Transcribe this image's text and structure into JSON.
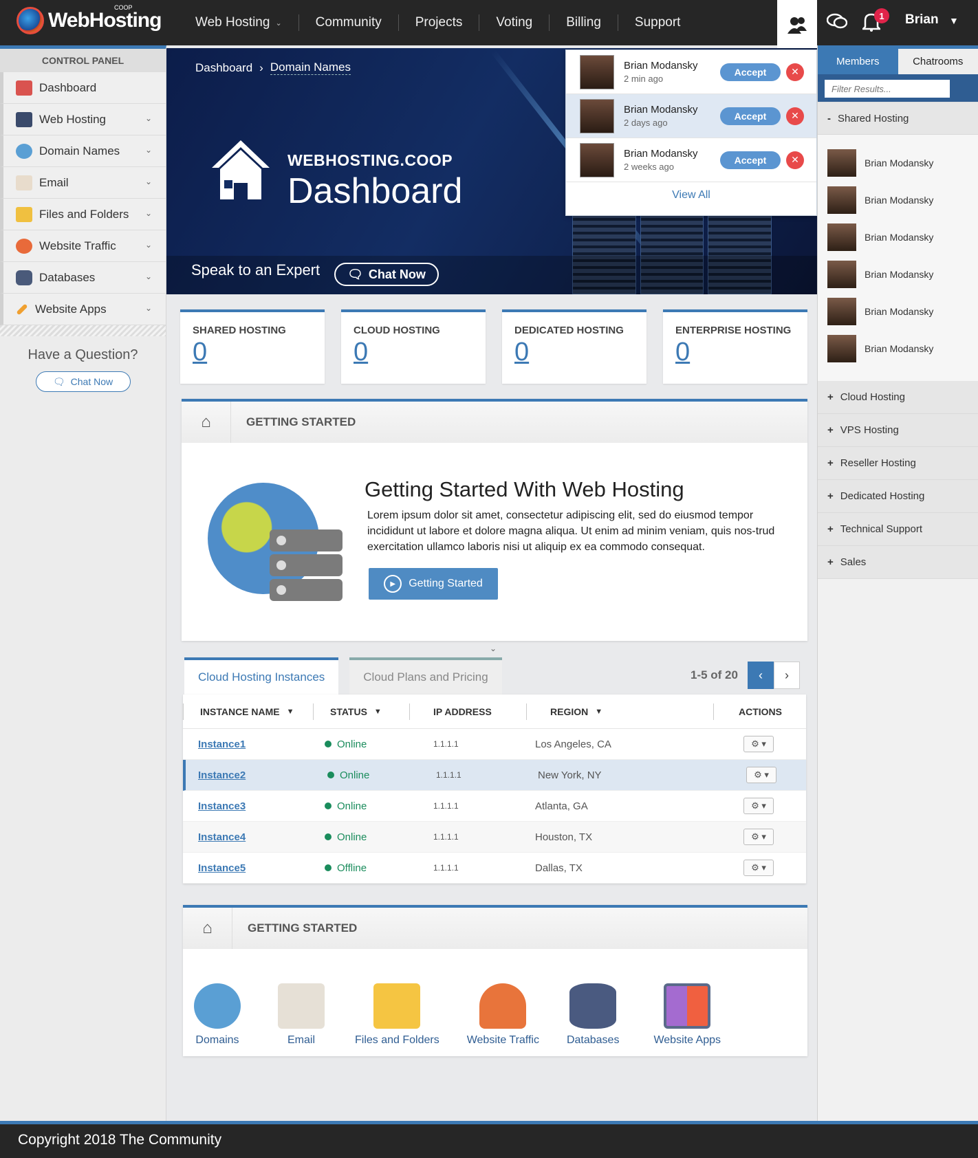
{
  "topbar": {
    "brand": "WebHosting",
    "brand_sup": "COOP",
    "nav": [
      {
        "label": "Web Hosting"
      },
      {
        "label": "Community"
      },
      {
        "label": "Projects"
      },
      {
        "label": "Voting"
      },
      {
        "label": "Billing"
      },
      {
        "label": "Support"
      }
    ],
    "notification_count": "1",
    "username": "Brian"
  },
  "sidebar": {
    "title": "CONTROL PANEL",
    "items": [
      {
        "label": "Dashboard",
        "icon": "store-icon",
        "color": "#d9534f"
      },
      {
        "label": "Web Hosting",
        "icon": "server-icon",
        "color": "#3a4a6b"
      },
      {
        "label": "Domain Names",
        "icon": "globe-icon",
        "color": "#5a9fd4"
      },
      {
        "label": "Email",
        "icon": "envelope-icon",
        "color": "#e8dccc"
      },
      {
        "label": "Files and Folders",
        "icon": "folder-icon",
        "color": "#f0c040"
      },
      {
        "label": "Website Traffic",
        "icon": "people-icon",
        "color": "#e86a3a"
      },
      {
        "label": "Databases",
        "icon": "database-icon",
        "color": "#4a5a7a"
      },
      {
        "label": "Website Apps",
        "icon": "pencil-icon",
        "color": "#f0a030"
      }
    ],
    "question": "Have a Question?",
    "chat_label": "Chat Now"
  },
  "hero": {
    "breadcrumb": [
      "Dashboard",
      "Domain Names"
    ],
    "brand": "WEBHOSTING.COOP",
    "title": "Dashboard",
    "speak": "Speak to an Expert",
    "chat_label": "Chat Now"
  },
  "notifications": {
    "items": [
      {
        "name": "Brian Modansky",
        "time": "2 min ago",
        "accept": "Accept"
      },
      {
        "name": "Brian Modansky",
        "time": "2 days ago",
        "accept": "Accept"
      },
      {
        "name": "Brian Modansky",
        "time": "2 weeks ago",
        "accept": "Accept"
      }
    ],
    "view_all": "View All"
  },
  "right_panel": {
    "tabs": [
      "Members",
      "Chatrooms"
    ],
    "filter_placeholder": "Filter Results...",
    "open_section": "Shared Hosting",
    "members": [
      "Brian Modansky",
      "Brian Modansky",
      "Brian Modansky",
      "Brian Modansky",
      "Brian Modansky",
      "Brian Modansky"
    ],
    "sections": [
      "Cloud Hosting",
      "VPS Hosting",
      "Reseller Hosting",
      "Dedicated Hosting",
      "Technical Support",
      "Sales"
    ]
  },
  "stats": [
    {
      "label": "SHARED HOSTING",
      "value": "0"
    },
    {
      "label": "CLOUD HOSTING",
      "value": "0"
    },
    {
      "label": "DEDICATED HOSTING",
      "value": "0"
    },
    {
      "label": "ENTERPRISE HOSTING",
      "value": "0"
    }
  ],
  "getting_started": {
    "header": "GETTING STARTED",
    "heading": "Getting Started With Web Hosting",
    "body": "Lorem ipsum dolor sit amet, consectetur adipiscing elit, sed do eiusmod tempor incididunt ut labore et dolore magna aliqua. Ut enim ad minim veniam, quis nos-trud exercitation ullamco laboris nisi ut aliquip ex ea commodo consequat.",
    "button": "Getting Started"
  },
  "instances": {
    "tabs": [
      "Cloud Hosting Instances",
      "Cloud Plans and Pricing"
    ],
    "pager": "1-5 of 20",
    "columns": [
      "INSTANCE NAME",
      "STATUS",
      "IP ADDRESS",
      "REGION",
      "ACTIONS"
    ],
    "rows": [
      {
        "name": "Instance1",
        "status": "Online",
        "ip": "1.1.1.1",
        "region": "Los Angeles, CA"
      },
      {
        "name": "Instance2",
        "status": "Online",
        "ip": "1.1.1.1",
        "region": "New York, NY"
      },
      {
        "name": "Instance3",
        "status": "Online",
        "ip": "1.1.1.1",
        "region": "Atlanta, GA"
      },
      {
        "name": "Instance4",
        "status": "Online",
        "ip": "1.1.1.1",
        "region": "Houston, TX"
      },
      {
        "name": "Instance5",
        "status": "Offline",
        "ip": "1.1.1.1",
        "region": "Dallas, TX"
      }
    ]
  },
  "getting_started_2": {
    "header": "GETTING STARTED",
    "apps": [
      {
        "label": "Domains",
        "icon": "globe-icon",
        "color": "#5a9fd4"
      },
      {
        "label": "Email",
        "icon": "envelope-icon",
        "color": "#e6e0d6"
      },
      {
        "label": "Files and Folders",
        "icon": "folder-icon",
        "color": "#f5c542"
      },
      {
        "label": "Website Traffic",
        "icon": "people-icon",
        "color": "#e8743b"
      },
      {
        "label": "Databases",
        "icon": "database-icon",
        "color": "#4a5a80"
      },
      {
        "label": "Website Apps",
        "icon": "app-grid-icon",
        "color": "#5a6a8a"
      }
    ]
  },
  "footer": {
    "copyright": "Copyright 2018 The Community"
  }
}
